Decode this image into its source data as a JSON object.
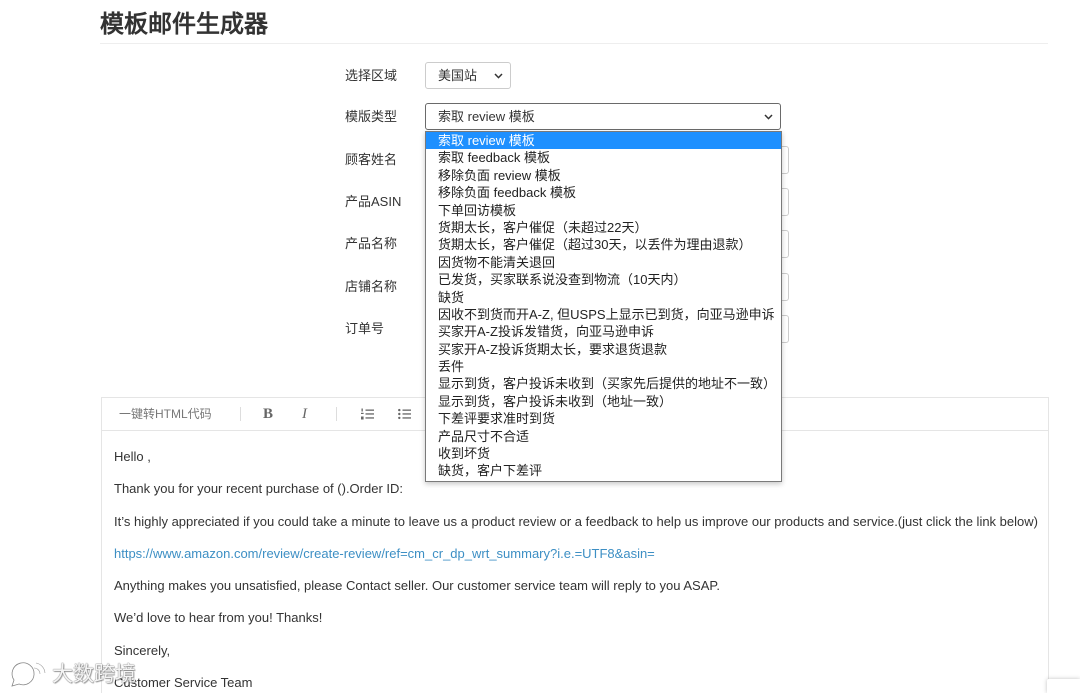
{
  "page": {
    "title": "模板邮件生成器"
  },
  "form": {
    "region": {
      "label": "选择区域",
      "value": "美国站"
    },
    "template_type": {
      "label": "模版类型",
      "value": "索取 review 模板",
      "highlighted_index": 0,
      "options": [
        "索取 review 模板",
        "索取 feedback 模板",
        "移除负面 review 模板",
        "移除负面 feedback 模板",
        "下单回访模板",
        "货期太长，客户催促（未超过22天）",
        "货期太长，客户催促（超过30天，以丢件为理由退款）",
        "因货物不能清关退回",
        "已发货，买家联系说没查到物流（10天内）",
        "缺货",
        "因收不到货而开A-Z, 但USPS上显示已到货，向亚马逊申诉",
        "买家开A-Z投诉发错货，向亚马逊申诉",
        "买家开A-Z投诉货期太长，要求退货退款",
        "丢件",
        "显示到货，客户投诉未收到（买家先后提供的地址不一致）",
        "显示到货，客户投诉未收到（地址一致）",
        "下差评要求准时到货",
        "产品尺寸不合适",
        "收到坏货",
        "缺货，客户下差评"
      ]
    },
    "customer_name": {
      "label": "顾客姓名"
    },
    "asin": {
      "label": "产品ASIN"
    },
    "product_name": {
      "label": "产品名称"
    },
    "store_name": {
      "label": "店铺名称"
    },
    "order_id": {
      "label": "订单号"
    }
  },
  "editor": {
    "toolbar": {
      "html_button": "一键转HTML代码",
      "bold_label": "B",
      "italic_label": "I",
      "icons": [
        "ordered-list-icon",
        "unordered-list-icon"
      ]
    },
    "content": [
      "Hello ,",
      "Thank you for your recent purchase of ().Order ID:",
      "It’s highly appreciated if you could take a minute to leave us a product review or a feedback to help us improve our products and service.(just click the link below)",
      "https://www.amazon.com/review/create-review/ref=cm_cr_dp_wrt_summary?i.e.=UTF8&asin=",
      "Anything makes you unsatisfied, please Contact seller. Our customer service team will reply to you ASAP.",
      "We’d love to hear from you! Thanks!",
      "Sincerely,",
      "Customer Service Team"
    ]
  },
  "watermark": {
    "text": "大数跨境"
  },
  "colors": {
    "text": "#333333",
    "highlight": "#1e90ff",
    "link": "#3d8fc4",
    "border": "#cccccc"
  }
}
